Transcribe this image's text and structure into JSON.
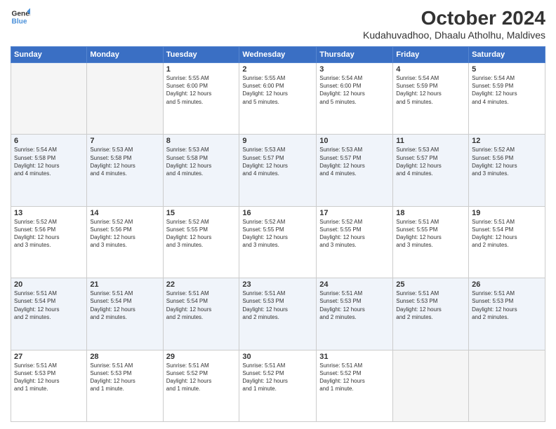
{
  "header": {
    "logo_line1": "General",
    "logo_line2": "Blue",
    "title": "October 2024",
    "subtitle": "Kudahuvadhoo, Dhaalu Atholhu, Maldives"
  },
  "weekdays": [
    "Sunday",
    "Monday",
    "Tuesday",
    "Wednesday",
    "Thursday",
    "Friday",
    "Saturday"
  ],
  "weeks": [
    [
      {
        "day": "",
        "info": ""
      },
      {
        "day": "",
        "info": ""
      },
      {
        "day": "1",
        "info": "Sunrise: 5:55 AM\nSunset: 6:00 PM\nDaylight: 12 hours\nand 5 minutes."
      },
      {
        "day": "2",
        "info": "Sunrise: 5:55 AM\nSunset: 6:00 PM\nDaylight: 12 hours\nand 5 minutes."
      },
      {
        "day": "3",
        "info": "Sunrise: 5:54 AM\nSunset: 6:00 PM\nDaylight: 12 hours\nand 5 minutes."
      },
      {
        "day": "4",
        "info": "Sunrise: 5:54 AM\nSunset: 5:59 PM\nDaylight: 12 hours\nand 5 minutes."
      },
      {
        "day": "5",
        "info": "Sunrise: 5:54 AM\nSunset: 5:59 PM\nDaylight: 12 hours\nand 4 minutes."
      }
    ],
    [
      {
        "day": "6",
        "info": "Sunrise: 5:54 AM\nSunset: 5:58 PM\nDaylight: 12 hours\nand 4 minutes."
      },
      {
        "day": "7",
        "info": "Sunrise: 5:53 AM\nSunset: 5:58 PM\nDaylight: 12 hours\nand 4 minutes."
      },
      {
        "day": "8",
        "info": "Sunrise: 5:53 AM\nSunset: 5:58 PM\nDaylight: 12 hours\nand 4 minutes."
      },
      {
        "day": "9",
        "info": "Sunrise: 5:53 AM\nSunset: 5:57 PM\nDaylight: 12 hours\nand 4 minutes."
      },
      {
        "day": "10",
        "info": "Sunrise: 5:53 AM\nSunset: 5:57 PM\nDaylight: 12 hours\nand 4 minutes."
      },
      {
        "day": "11",
        "info": "Sunrise: 5:53 AM\nSunset: 5:57 PM\nDaylight: 12 hours\nand 4 minutes."
      },
      {
        "day": "12",
        "info": "Sunrise: 5:52 AM\nSunset: 5:56 PM\nDaylight: 12 hours\nand 3 minutes."
      }
    ],
    [
      {
        "day": "13",
        "info": "Sunrise: 5:52 AM\nSunset: 5:56 PM\nDaylight: 12 hours\nand 3 minutes."
      },
      {
        "day": "14",
        "info": "Sunrise: 5:52 AM\nSunset: 5:56 PM\nDaylight: 12 hours\nand 3 minutes."
      },
      {
        "day": "15",
        "info": "Sunrise: 5:52 AM\nSunset: 5:55 PM\nDaylight: 12 hours\nand 3 minutes."
      },
      {
        "day": "16",
        "info": "Sunrise: 5:52 AM\nSunset: 5:55 PM\nDaylight: 12 hours\nand 3 minutes."
      },
      {
        "day": "17",
        "info": "Sunrise: 5:52 AM\nSunset: 5:55 PM\nDaylight: 12 hours\nand 3 minutes."
      },
      {
        "day": "18",
        "info": "Sunrise: 5:51 AM\nSunset: 5:55 PM\nDaylight: 12 hours\nand 3 minutes."
      },
      {
        "day": "19",
        "info": "Sunrise: 5:51 AM\nSunset: 5:54 PM\nDaylight: 12 hours\nand 2 minutes."
      }
    ],
    [
      {
        "day": "20",
        "info": "Sunrise: 5:51 AM\nSunset: 5:54 PM\nDaylight: 12 hours\nand 2 minutes."
      },
      {
        "day": "21",
        "info": "Sunrise: 5:51 AM\nSunset: 5:54 PM\nDaylight: 12 hours\nand 2 minutes."
      },
      {
        "day": "22",
        "info": "Sunrise: 5:51 AM\nSunset: 5:54 PM\nDaylight: 12 hours\nand 2 minutes."
      },
      {
        "day": "23",
        "info": "Sunrise: 5:51 AM\nSunset: 5:53 PM\nDaylight: 12 hours\nand 2 minutes."
      },
      {
        "day": "24",
        "info": "Sunrise: 5:51 AM\nSunset: 5:53 PM\nDaylight: 12 hours\nand 2 minutes."
      },
      {
        "day": "25",
        "info": "Sunrise: 5:51 AM\nSunset: 5:53 PM\nDaylight: 12 hours\nand 2 minutes."
      },
      {
        "day": "26",
        "info": "Sunrise: 5:51 AM\nSunset: 5:53 PM\nDaylight: 12 hours\nand 2 minutes."
      }
    ],
    [
      {
        "day": "27",
        "info": "Sunrise: 5:51 AM\nSunset: 5:53 PM\nDaylight: 12 hours\nand 1 minute."
      },
      {
        "day": "28",
        "info": "Sunrise: 5:51 AM\nSunset: 5:53 PM\nDaylight: 12 hours\nand 1 minute."
      },
      {
        "day": "29",
        "info": "Sunrise: 5:51 AM\nSunset: 5:52 PM\nDaylight: 12 hours\nand 1 minute."
      },
      {
        "day": "30",
        "info": "Sunrise: 5:51 AM\nSunset: 5:52 PM\nDaylight: 12 hours\nand 1 minute."
      },
      {
        "day": "31",
        "info": "Sunrise: 5:51 AM\nSunset: 5:52 PM\nDaylight: 12 hours\nand 1 minute."
      },
      {
        "day": "",
        "info": ""
      },
      {
        "day": "",
        "info": ""
      }
    ]
  ],
  "row_classes": [
    "row-odd",
    "row-even",
    "row-odd",
    "row-even",
    "row-odd"
  ]
}
